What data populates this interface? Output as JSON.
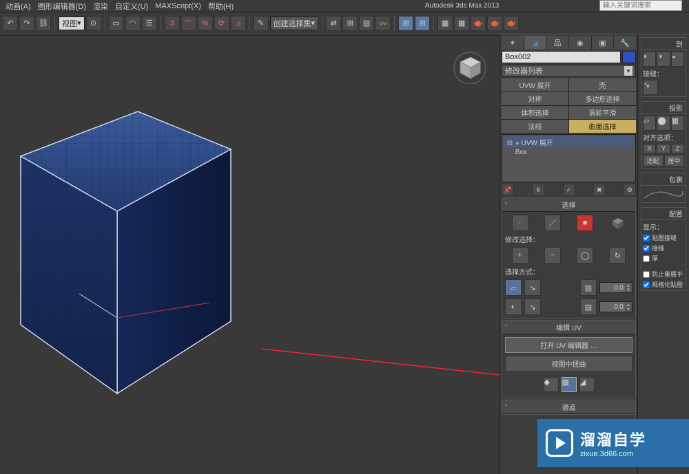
{
  "app_title": "Autodesk 3ds Max 2013",
  "searchbox_placeholder": "输入关键词搜索",
  "menu": [
    "动画(A)",
    "图形编辑器(D)",
    "渲染",
    "自定义(U)",
    "MAXScript(X)",
    "帮助(H)"
  ],
  "toolbar": {
    "view_dd": "视图",
    "num": "3",
    "selset_dd": "创建选择集"
  },
  "command_panel": {
    "obj_name": "Box002",
    "modifier_dd": "修改器列表",
    "mod_grid": [
      {
        "l": "UVW 展开",
        "r": "壳"
      },
      {
        "l": "对称",
        "r": "多边形选择"
      },
      {
        "l": "体积选择",
        "r": "涡轮平滑"
      },
      {
        "l": "法线",
        "r": "曲面选择"
      }
    ],
    "stack": [
      {
        "label": "UVW 展开",
        "exp": "⊟",
        "bulb": "●",
        "sel": true
      },
      {
        "label": "Box",
        "exp": "",
        "bulb": "",
        "sel": false
      }
    ],
    "rollout_select": {
      "title": "选择",
      "mod_select_label": "修改选择：",
      "select_by_label": "选择方式：",
      "val": "0.0"
    },
    "rollout_edituv": {
      "title": "编辑 UV",
      "btn_open": "打开 UV 编辑器 …",
      "btn_distort": "视图中扭曲"
    },
    "rollout_channel": {
      "title": "通道"
    }
  },
  "panel2": {
    "sections": {
      "split": "剖",
      "seam": "接缝：",
      "project": "投影",
      "align": "对齐选项：",
      "axes": [
        "X",
        "Y",
        "Z"
      ],
      "fit": "适配",
      "center": "居中",
      "wrap": "包裹",
      "config": "配置",
      "display": "显示：",
      "chk_map": "贴图接缝",
      "chk_seam": "接缝",
      "chk_thick": "厚",
      "chk_prevent": "防止重展平",
      "chk_normalize": "规格化贴图"
    }
  },
  "watermark": {
    "main": "溜溜自学",
    "sub": "zixue.3d66.com"
  }
}
